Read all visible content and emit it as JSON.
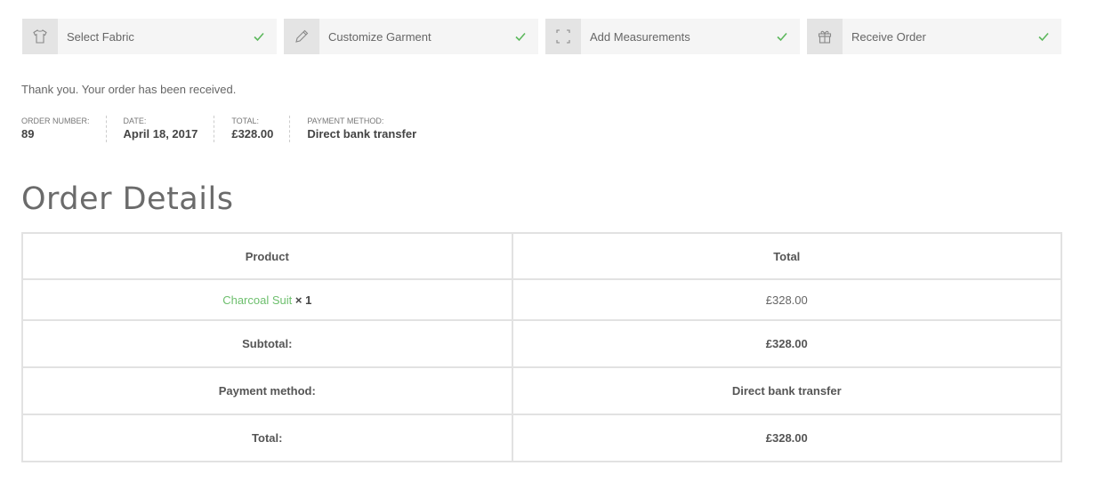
{
  "steps": [
    {
      "label": "Select Fabric",
      "icon": "shirt-icon"
    },
    {
      "label": "Customize Garment",
      "icon": "pencil-icon"
    },
    {
      "label": "Add Measurements",
      "icon": "measure-icon"
    },
    {
      "label": "Receive Order",
      "icon": "gift-icon"
    }
  ],
  "colors": {
    "check": "#5cb85c",
    "link": "#6dbf6d"
  },
  "thank_you": "Thank you. Your order has been received.",
  "overview": {
    "order_number_label": "ORDER NUMBER:",
    "order_number": "89",
    "date_label": "DATE:",
    "date": "April 18, 2017",
    "total_label": "TOTAL:",
    "total": "£328.00",
    "payment_label": "PAYMENT METHOD:",
    "payment": "Direct bank transfer"
  },
  "order_details": {
    "heading": "Order Details",
    "col_product": "Product",
    "col_total": "Total",
    "item": {
      "name": "Charcoal Suit",
      "qty": "× 1",
      "total": "£328.00"
    },
    "subtotal_label": "Subtotal:",
    "subtotal": "£328.00",
    "payment_label": "Payment method:",
    "payment": "Direct bank transfer",
    "total_label": "Total:",
    "total": "£328.00"
  }
}
